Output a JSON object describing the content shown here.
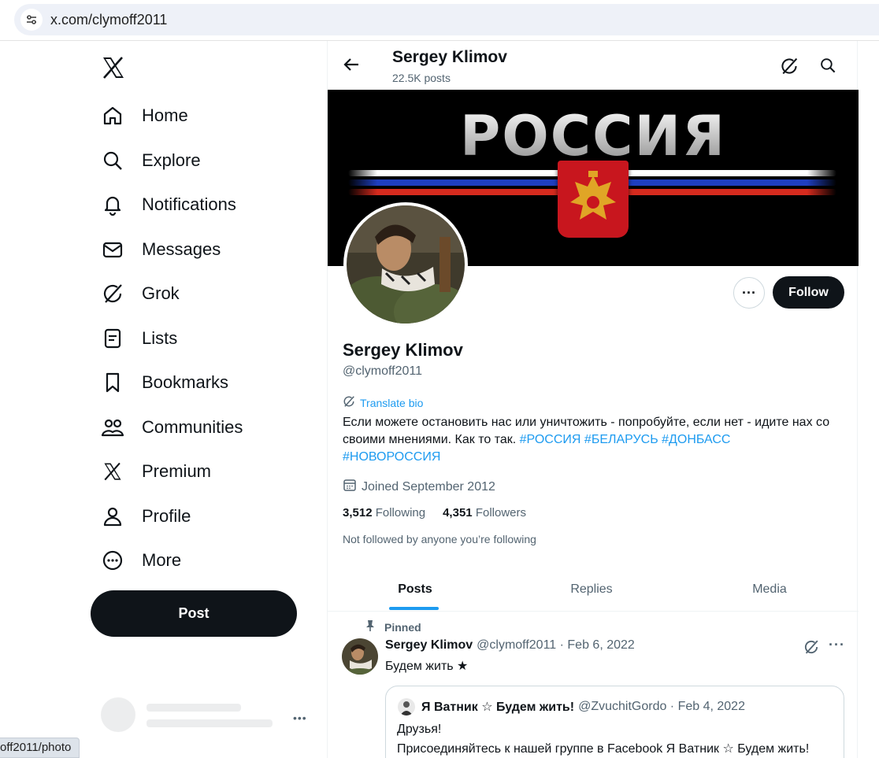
{
  "browser": {
    "url": "x.com/clymoff2011"
  },
  "status_tooltip": "off2011/photo",
  "nav": {
    "items": [
      {
        "label": "Home",
        "icon": "home-icon"
      },
      {
        "label": "Explore",
        "icon": "search-icon"
      },
      {
        "label": "Notifications",
        "icon": "bell-icon"
      },
      {
        "label": "Messages",
        "icon": "envelope-icon"
      },
      {
        "label": "Grok",
        "icon": "grok-icon"
      },
      {
        "label": "Lists",
        "icon": "list-icon"
      },
      {
        "label": "Bookmarks",
        "icon": "bookmark-icon"
      },
      {
        "label": "Communities",
        "icon": "people-icon"
      },
      {
        "label": "Premium",
        "icon": "x-logo-icon"
      },
      {
        "label": "Profile",
        "icon": "person-icon"
      },
      {
        "label": "More",
        "icon": "more-circle-icon"
      }
    ],
    "post_label": "Post"
  },
  "topbar": {
    "name": "Sergey Klimov",
    "post_count": "22.5K posts"
  },
  "banner": {
    "title": "РОССИЯ"
  },
  "profile": {
    "name": "Sergey Klimov",
    "handle": "@clymoff2011",
    "translate_label": "Translate bio",
    "bio_text": "Если можете остановить нас или уничтожить - попробуйте, если нет - идите нах со своими мнениями. Как то так. ",
    "bio_tags": [
      "#РОССИЯ",
      "#БЕЛАРУСЬ",
      "#ДОНБАСС",
      "#НОВОРОССИЯ"
    ],
    "joined": "Joined September 2012",
    "following_count": "3,512",
    "following_label": "Following",
    "followers_count": "4,351",
    "followers_label": "Followers",
    "not_followed": "Not followed by anyone you’re following",
    "follow_label": "Follow",
    "more_label": "···"
  },
  "tabs": [
    "Posts",
    "Replies",
    "Media"
  ],
  "tweet": {
    "pinned_label": "Pinned",
    "name": "Sergey Klimov",
    "meta": "@clymoff2011 · Feb 6, 2022",
    "text": "Будем жить ★",
    "quote": {
      "name": "Я Ватник ☆ Будем жить!",
      "meta": "@ZvuchitGordo · Feb 4, 2022",
      "line1": "Друзья!",
      "line2": "Присоединяйтесь к нашей группе в Facebook Я Ватник ☆ Будем жить!"
    }
  },
  "colors": {
    "accent": "#1d9bf0",
    "text": "#0f1419",
    "muted": "#536471",
    "button": "#0f1419"
  }
}
